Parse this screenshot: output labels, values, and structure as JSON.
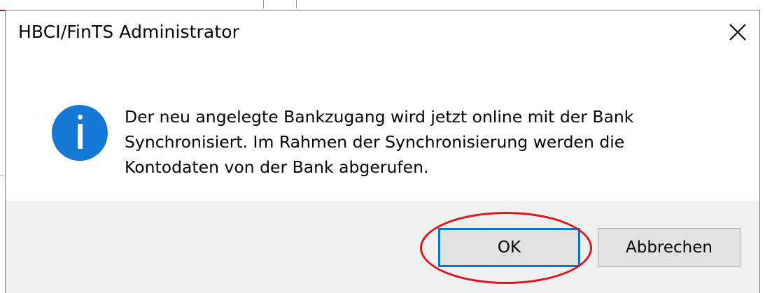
{
  "dialog": {
    "title": "HBCI/FinTS Administrator",
    "icon": "info-icon",
    "message_lines": [
      "Der neu angelegte Bankzugang wird jetzt online mit der Bank",
      "Synchronisiert. Im Rahmen der Synchronisierung werden die",
      "Kontodaten von der Bank abgerufen."
    ],
    "buttons": {
      "ok": "OK",
      "cancel": "Abbrechen"
    },
    "close_icon": "close-icon"
  },
  "colors": {
    "info_icon": "#1478d4",
    "focus_border": "#0078d7",
    "highlight": "#e0141b",
    "footer_bg": "#f0f0f0"
  }
}
